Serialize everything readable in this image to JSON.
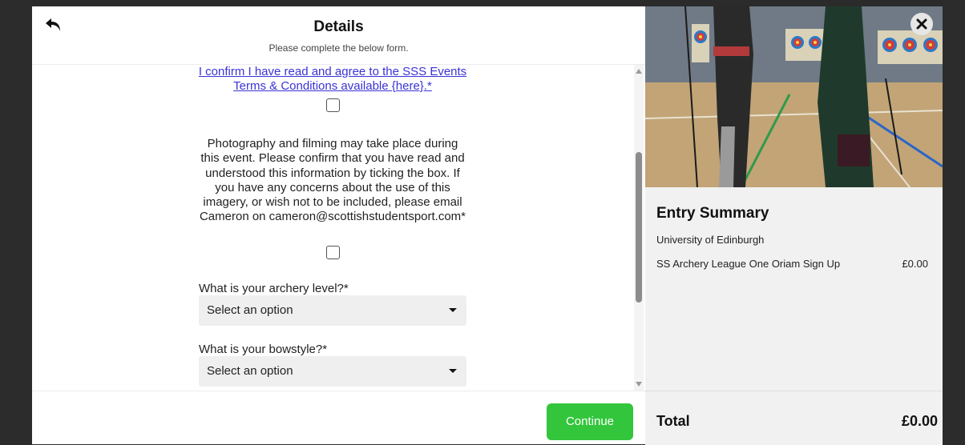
{
  "header": {
    "title": "Details",
    "subtitle": "Please complete the below form."
  },
  "form": {
    "terms_link": "I confirm I have read and agree to the SSS Events Terms & Conditions available {here}.*",
    "photo_notice": "Photography and filming may take place during this event. Please confirm that you have read and understood this information by ticking the box. If you have any concerns about the use of this imagery, or wish not to be included, please email Cameron on cameron@scottishstudentsport.com*",
    "archery_level": {
      "label": "What is your archery level?*",
      "value": "Select an option"
    },
    "bowstyle": {
      "label": "What is your bowstyle?*",
      "value": "Select an option"
    },
    "continue_label": "Continue"
  },
  "summary": {
    "title": "Entry Summary",
    "organisation": "University of Edinburgh",
    "items": [
      {
        "name": "SS Archery League One Oriam Sign Up",
        "price": "£0.00"
      }
    ],
    "total_label": "Total",
    "total_value": "£0.00"
  },
  "icons": {
    "back": "back-arrow-icon",
    "close": "close-icon",
    "select_caret": "caret-down-icon"
  },
  "colors": {
    "continue_button": "#33c63c",
    "link": "#3a33d6"
  }
}
